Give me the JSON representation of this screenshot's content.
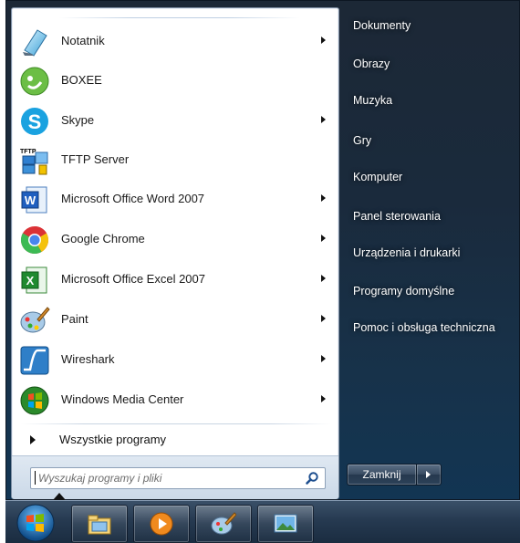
{
  "programs": [
    {
      "label": "Notatnik",
      "icon": "notepad-icon",
      "has_submenu": true
    },
    {
      "label": "BOXEE",
      "icon": "boxee-icon",
      "has_submenu": false
    },
    {
      "label": "Skype",
      "icon": "skype-icon",
      "has_submenu": true
    },
    {
      "label": "TFTP Server",
      "icon": "tftp-server-icon",
      "has_submenu": false
    },
    {
      "label": "Microsoft Office Word 2007",
      "icon": "word-icon",
      "has_submenu": true
    },
    {
      "label": "Google Chrome",
      "icon": "chrome-icon",
      "has_submenu": true
    },
    {
      "label": "Microsoft Office Excel 2007",
      "icon": "excel-icon",
      "has_submenu": true
    },
    {
      "label": "Paint",
      "icon": "paint-icon",
      "has_submenu": true
    },
    {
      "label": "Wireshark",
      "icon": "wireshark-icon",
      "has_submenu": true
    },
    {
      "label": "Windows Media Center",
      "icon": "media-center-icon",
      "has_submenu": true
    }
  ],
  "all_programs": "Wszystkie programy",
  "search": {
    "placeholder": "Wyszukaj programy i pliki"
  },
  "right_pane": [
    "Dokumenty",
    "Obrazy",
    "Muzyka",
    "Gry",
    "Komputer",
    "Panel sterowania",
    "Urządzenia i drukarki",
    "Programy domyślne",
    "Pomoc i obsługa techniczna"
  ],
  "shutdown": {
    "label": "Zamknij"
  },
  "tftp_label": "TFTP",
  "taskbar": [
    {
      "icon": "explorer-icon"
    },
    {
      "icon": "media-player-icon"
    },
    {
      "icon": "paint-icon"
    },
    {
      "icon": "photo-viewer-icon"
    }
  ]
}
